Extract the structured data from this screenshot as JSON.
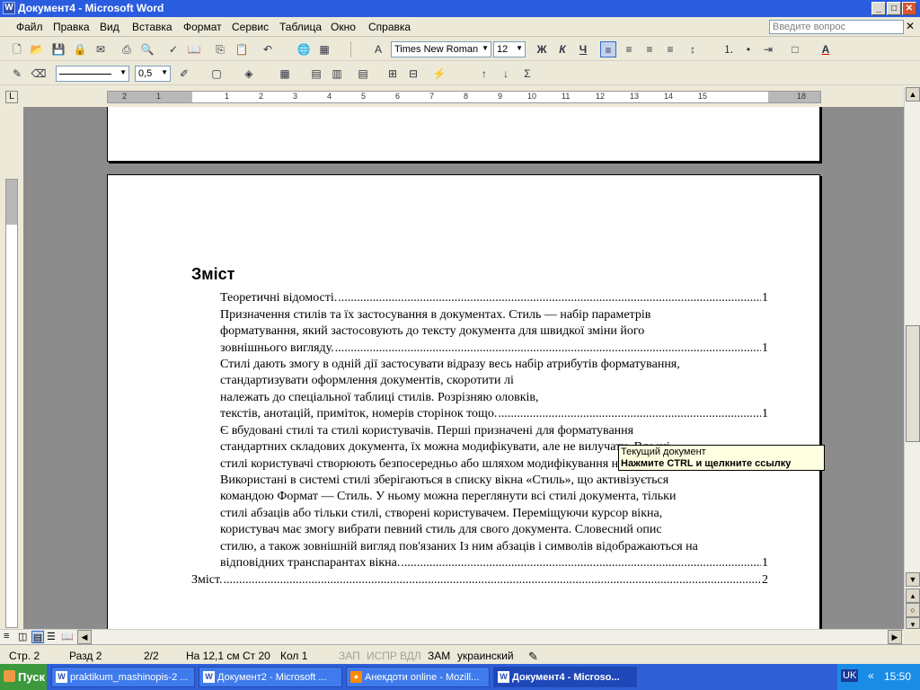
{
  "window": {
    "title": "Документ4 - Microsoft Word"
  },
  "menu": {
    "items": [
      "Файл",
      "Правка",
      "Вид",
      "Вставка",
      "Формат",
      "Сервис",
      "Таблица",
      "Окно",
      "Справка"
    ],
    "ask_placeholder": "Введите вопрос"
  },
  "formatting": {
    "font_name": "Times New Roman",
    "font_size": "12",
    "bold": "Ж",
    "italic": "К",
    "underline": "Ч"
  },
  "tables_bar": {
    "line_weight": "0,5"
  },
  "ruler": {
    "ticks": [
      "2",
      "1",
      "1",
      "2",
      "3",
      "4",
      "5",
      "6",
      "7",
      "8",
      "9",
      "10",
      "11",
      "12",
      "13",
      "14",
      "15",
      "16",
      "18"
    ]
  },
  "document": {
    "heading": "Зміст",
    "toc": [
      {
        "lines": [
          "Теоретичні відомості."
        ],
        "page": "1"
      },
      {
        "lines": [
          "Призначення стилів та їх застосування в документах. Стиль — набір параметрів",
          "форматування, який застосовують до тексту документа для швидкої зміни його",
          "зовнішнього вигляду."
        ],
        "page": "1"
      },
      {
        "lines": [
          "Стилі дають змогу в одній дії застосувати відразу весь набір атрибутів форматування,",
          "стандартизувати оформлення документів, скоротити                                   лі",
          "належать до спеціальної таблиці стилів. Розрізняю                                 оловків,",
          "текстів, анотацій, приміток, номерів сторінок тощо."
        ],
        "page": "1"
      },
      {
        "lines": [
          "Є вбудовані стилі та стилі користувачів. Перші призначені для форматування",
          "стандартних складових документа, їх можна модифікувати, але не вилучати. Власні",
          "стилі користувачі створюють безпосередньо або шляхом модифікування наявних."
        ],
        "page": "1"
      },
      {
        "lines": [
          "Використані в системі стилі зберігаються в списку вікна «Стиль», що активізується",
          "командою Формат — Стиль. У ньому можна переглянути всі стилі документа, тільки",
          "стилі абзаців або тільки стилі, створені користувачем. Переміщуючи курсор вікна,",
          "користувач має змогу вибрати певний стиль для свого документа. Словесний опис",
          "стилю, а також зовнішній вигляд пов'язаних Із ним абзаців і символів відображаються на",
          "відповідних транспарантах вікна."
        ],
        "page": "1"
      }
    ],
    "toc_last": {
      "text": "Зміст.",
      "page": "2"
    }
  },
  "tooltip": {
    "line1": "Текущий документ",
    "line2": "Нажмите CTRL и щелкните ссылку"
  },
  "statusbar": {
    "page": "Стр. 2",
    "section": "Разд 2",
    "pages": "2/2",
    "at": "На 12,1 см",
    "line": "Ст 20",
    "col": "Кол 1",
    "rec": "ЗАП",
    "trk": "ИСПР",
    "ext": "ВДЛ",
    "ovr": "ЗАМ",
    "lang": "украинский"
  },
  "taskbar": {
    "start": "Пуск",
    "tasks": [
      "praktikum_mashinopis-2 ...",
      "Документ2 - Microsoft ...",
      "Анекдоти online - Mozill...",
      "Документ4 - Microso..."
    ],
    "lang": "UK",
    "clock": "15:50"
  }
}
